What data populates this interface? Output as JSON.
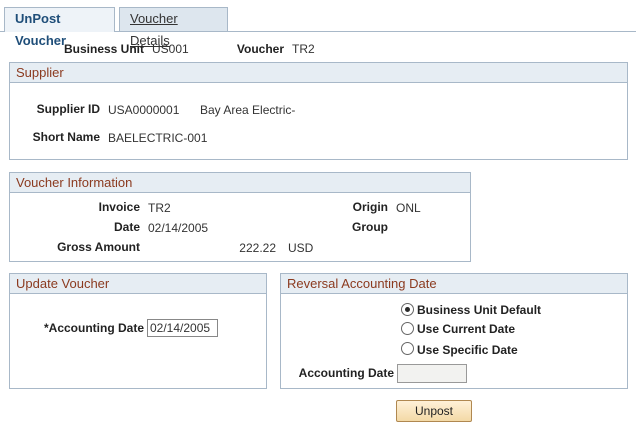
{
  "tabs": [
    {
      "label": "UnPost Voucher"
    },
    {
      "label": "Voucher Details"
    }
  ],
  "header": {
    "business_unit_label": "Business Unit",
    "business_unit": "US001",
    "voucher_label": "Voucher",
    "voucher": "TR2"
  },
  "supplier": {
    "title": "Supplier",
    "id_label": "Supplier ID",
    "id": "USA0000001",
    "name": "Bay Area Electric-",
    "short_name_label": "Short Name",
    "short_name": "BAELECTRIC-001"
  },
  "voucher_info": {
    "title": "Voucher Information",
    "invoice_label": "Invoice",
    "invoice": "TR2",
    "date_label": "Date",
    "date": "02/14/2005",
    "gross_label": "Gross Amount",
    "gross_amount": "222.22",
    "currency": "USD",
    "origin_label": "Origin",
    "origin": "ONL",
    "group_label": "Group",
    "group": ""
  },
  "update_voucher": {
    "title": "Update Voucher",
    "accounting_date_label": "*Accounting Date",
    "accounting_date": "02/14/2005"
  },
  "reversal": {
    "title": "Reversal Accounting Date",
    "options": [
      {
        "label": "Business Unit Default",
        "selected": true
      },
      {
        "label": "Use Current Date",
        "selected": false
      },
      {
        "label": "Use Specific Date",
        "selected": false
      }
    ],
    "accounting_date_label": "Accounting Date",
    "accounting_date": ""
  },
  "actions": {
    "unpost_label": "Unpost"
  }
}
